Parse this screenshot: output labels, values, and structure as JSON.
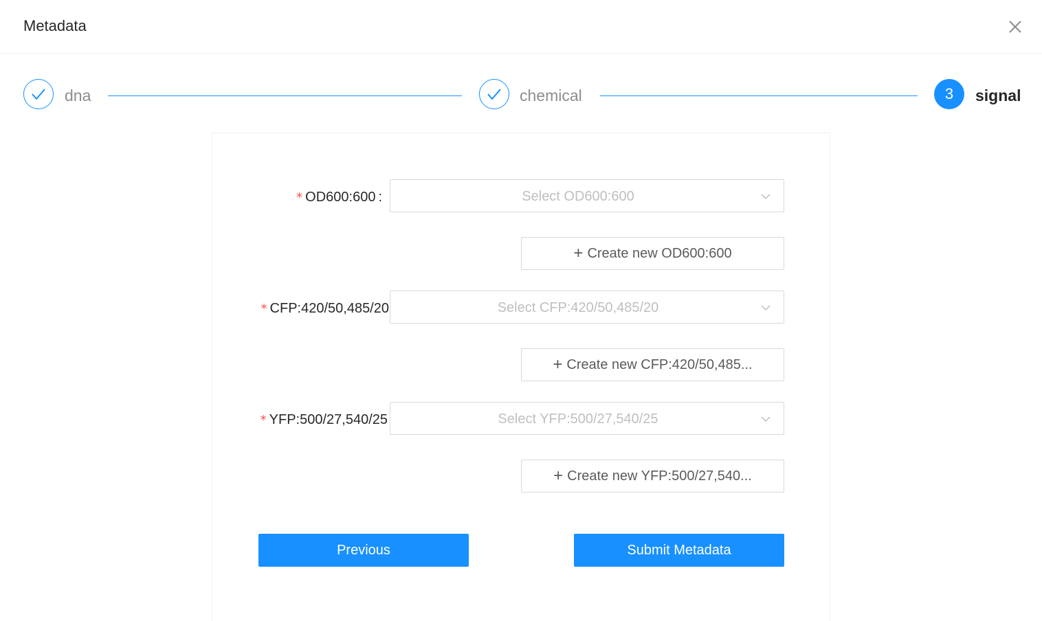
{
  "modal": {
    "title": "Metadata",
    "close_icon": "close-icon"
  },
  "steps": [
    {
      "title": "dna",
      "status": "finish",
      "icon": "check-icon"
    },
    {
      "title": "chemical",
      "status": "finish",
      "icon": "check-icon"
    },
    {
      "title": "signal",
      "status": "process",
      "number": "3"
    }
  ],
  "form": {
    "fields": [
      {
        "label": "OD600:600",
        "label_colon": ":",
        "required": true,
        "required_mark": "*",
        "placeholder": "Select OD600:600",
        "create_label": "Create new OD600:600"
      },
      {
        "label": "CFP:420/50,485/20",
        "label_colon": "",
        "required": true,
        "required_mark": "*",
        "placeholder": "Select CFP:420/50,485/20",
        "create_label": "Create new CFP:420/50,485..."
      },
      {
        "label": "YFP:500/27,540/25",
        "label_colon": "",
        "required": true,
        "required_mark": "*",
        "placeholder": "Select YFP:500/27,540/25",
        "create_label": "Create new YFP:500/27,540..."
      }
    ],
    "previous_label": "Previous",
    "submit_label": "Submit Metadata"
  },
  "colors": {
    "primary": "#1890ff",
    "required": "#ff4d4f",
    "placeholder": "#bfbfbf",
    "border": "#d9d9d9"
  }
}
